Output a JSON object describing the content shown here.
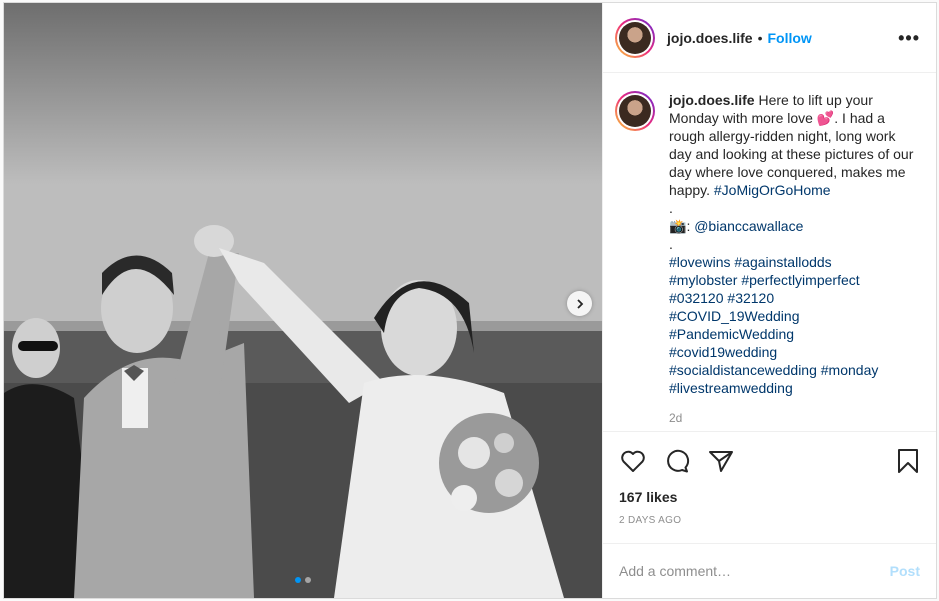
{
  "post": {
    "username": "jojo.does.life",
    "separator": "•",
    "follow_label": "Follow",
    "more_label": "•••",
    "caption": {
      "intro": " Here to lift up your Monday with more love ",
      "emoji": "💕",
      "body": ". I had a rough allergy-ridden night, long work day and looking at these pictures of our day where love conquered, makes me happy. ",
      "hashtag_main": "#JoMigOrGoHome",
      "dot1": ".",
      "camera_emoji": "📸",
      "credit_prefix": ": ",
      "credit": "@bianccawallace",
      "dot2": ".",
      "hashtags": [
        "#lovewins",
        "#againstallodds",
        "#mylobster",
        "#perfectlyimperfect",
        "#032120",
        "#32120",
        "#COVID_19Wedding",
        "#PandemicWedding",
        "#covid19wedding",
        "#socialdistancewedding",
        "#monday",
        "#livestreamwedding"
      ]
    },
    "comment_age": "2d",
    "likes": "167 likes",
    "date": "2 DAYS AGO",
    "comment_placeholder": "Add a comment…",
    "post_label": "Post",
    "carousel": {
      "count": 2,
      "active": 0
    },
    "colors": {
      "accent": "#0095f6",
      "hashtag": "#00376b",
      "muted": "#8e8e8e"
    },
    "icons": [
      "heart-icon",
      "comment-icon",
      "share-icon",
      "bookmark-icon",
      "chevron-right-icon"
    ]
  }
}
